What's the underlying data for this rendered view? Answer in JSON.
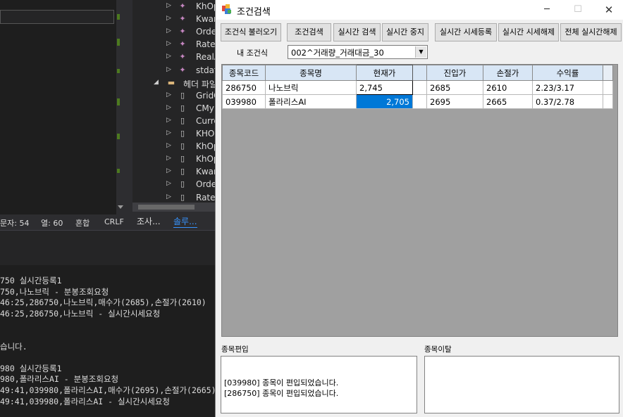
{
  "ide": {
    "tree_items": [
      {
        "label": "KhOp",
        "icon": "field-icon"
      },
      {
        "label": "Kwar",
        "icon": "field-icon"
      },
      {
        "label": "Orde",
        "icon": "field-icon"
      },
      {
        "label": "RateI",
        "icon": "field-icon"
      },
      {
        "label": "RealA",
        "icon": "field-icon"
      },
      {
        "label": "stdaf",
        "icon": "field-icon"
      },
      {
        "label": "헤더 파일",
        "icon": "folder-icon"
      },
      {
        "label": "GridC",
        "icon": "file-icon"
      },
      {
        "label": "CMy",
        "icon": "file-icon"
      },
      {
        "label": "Curre",
        "icon": "file-icon"
      },
      {
        "label": "KHO",
        "icon": "file-icon"
      },
      {
        "label": "KhOp",
        "icon": "file-icon"
      },
      {
        "label": "KhOp",
        "icon": "file-icon"
      },
      {
        "label": "Kwar",
        "icon": "file-icon"
      },
      {
        "label": "Orde",
        "icon": "file-icon"
      },
      {
        "label": "RateI",
        "icon": "file-icon"
      }
    ],
    "status": {
      "chars": "문자: 54",
      "col": "열: 60",
      "mode": "혼합",
      "eol": "CRLF"
    },
    "tabs": [
      "조사...",
      "솔루..."
    ],
    "output_lines": [
      "750 실시간등록1",
      "750,나노브릭 - 분봉조회요청",
      "46:25,286750,나노브릭,매수가(2685),손절가(2610)",
      "46:25,286750,나노브릭 - 실시간시세요청",
      "",
      "",
      "습니다.",
      "",
      "980 실시간등록1",
      "980,폴라리스AI - 분봉조회요청",
      "49:41,039980,폴라리스AI,매수가(2695),손절가(2665)",
      "49:41,039980,폴라리스AI - 실시간시세요청",
      "                                  "
    ]
  },
  "window": {
    "title": "조건검색",
    "controls": {
      "minimize": "─",
      "maximize": "☐",
      "close": "✕"
    }
  },
  "toolbar": {
    "load_condition": "조건식 불러오기",
    "search": "조건검색",
    "realtime_search": "실시간 검색",
    "realtime_stop": "실시간 중지",
    "realtime_price_register": "실시간 시세등록",
    "realtime_price_unregister": "실시간 시세해제",
    "all_realtime_unregister": "전체 실시간해제"
  },
  "condition": {
    "label": "내 조건식",
    "selected": "002^거래량_거래대금_30"
  },
  "grid": {
    "columns": [
      "종목코드",
      "종목명",
      "현재가",
      "",
      "진입가",
      "손절가",
      "수익률"
    ],
    "rows": [
      {
        "code": "286750",
        "name": "나노브릭",
        "price": "2,745",
        "entry": "2685",
        "stop": "2610",
        "ret": "2.23/3.17"
      },
      {
        "code": "039980",
        "name": "폴라리스AI",
        "price": "2,705",
        "entry": "2695",
        "stop": "2665",
        "ret": "0.37/2.78"
      }
    ]
  },
  "incoming": {
    "label": "종목편입",
    "lines": [
      "[039980] 종목이 편입되었습니다.",
      "[286750] 종목이 편입되었습니다."
    ]
  },
  "outgoing": {
    "label": "종목이탈",
    "lines": []
  }
}
